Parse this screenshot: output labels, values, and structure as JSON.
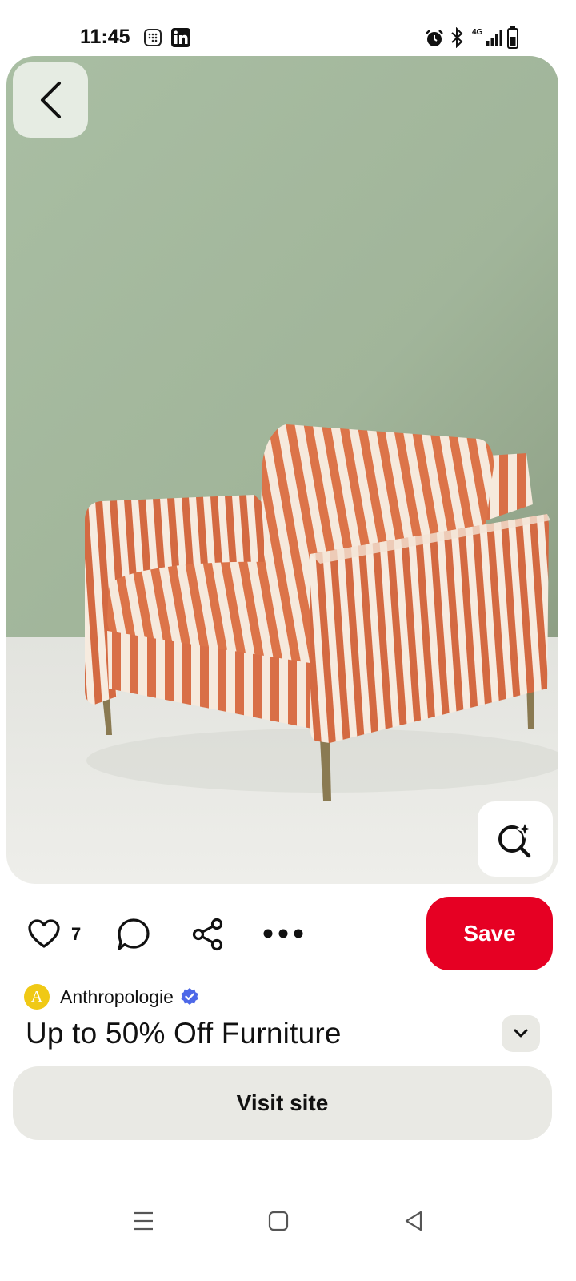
{
  "status_bar": {
    "time": "11:45",
    "network": "4G",
    "icons": [
      "grid-notification-icon",
      "linkedin-icon",
      "alarm-icon",
      "bluetooth-icon",
      "signal-icon",
      "battery-icon"
    ]
  },
  "pin": {
    "image_alt": "Striped orange and cream armchair with brass legs against a sage green wall",
    "like_count": "7",
    "save_label": "Save",
    "creator": {
      "initial": "A",
      "name": "Anthropologie",
      "verified": true
    },
    "title": "Up to 50% Off Furniture",
    "visit_site_label": "Visit site"
  },
  "colors": {
    "save_red": "#e60023",
    "wall_green": "#a5b89c",
    "floor": "#e6e7e2",
    "stripe_orange": "#d96f47",
    "stripe_cream": "#f6e9dc",
    "avatar_yellow": "#f0c915",
    "verified_blue": "#4d68e8",
    "button_gray": "#e9e9e4"
  },
  "nav": {
    "icons": [
      "menu-icon",
      "home-square-icon",
      "back-triangle-icon"
    ]
  }
}
